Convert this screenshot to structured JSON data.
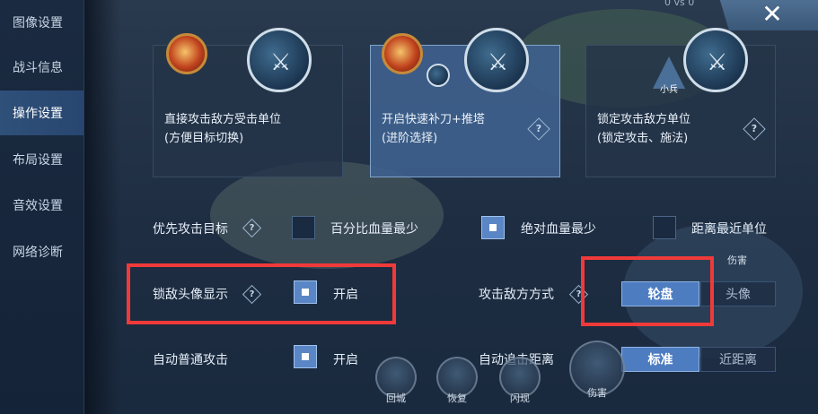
{
  "sidebar": {
    "items": [
      {
        "label": "图像设置"
      },
      {
        "label": "战斗信息"
      },
      {
        "label": "操作设置"
      },
      {
        "label": "布局设置"
      },
      {
        "label": "音效设置"
      },
      {
        "label": "网络诊断"
      }
    ],
    "active_index": 2
  },
  "header": {
    "close_glyph": "✕",
    "score_text": "0 vs 0"
  },
  "cards": [
    {
      "title": "直接攻击敌方受击单位",
      "subtitle": "(方便目标切换)",
      "selected": false
    },
    {
      "title": "开启快速补刀+推塔",
      "subtitle": "(进阶选择)",
      "selected": true
    },
    {
      "title": "锁定攻击敌方单位",
      "subtitle": "(锁定攻击、施法)",
      "selected": false,
      "tag": "小兵"
    }
  ],
  "help_glyph": "?",
  "settings": {
    "priority_target": {
      "label": "优先攻击目标",
      "options": [
        {
          "label": "百分比血量最少",
          "checked": false
        },
        {
          "label": "绝对血量最少",
          "checked": true
        },
        {
          "label": "距离最近单位",
          "checked": false
        }
      ]
    },
    "lock_avatar": {
      "label": "锁敌头像显示",
      "checked": true,
      "value_label": "开启"
    },
    "attack_mode": {
      "label": "攻击敌方方式",
      "options": [
        "轮盘",
        "头像"
      ],
      "selected": "轮盘"
    },
    "auto_attack": {
      "label": "自动普通攻击",
      "checked": true,
      "value_label": "开启"
    },
    "chase_distance": {
      "label": "自动追击距离",
      "options": [
        "标准",
        "近距离"
      ],
      "selected": "标准"
    }
  },
  "background_labels": {
    "skill_1": "回城",
    "skill_2": "恢复",
    "skill_3": "闪现",
    "skill_4": "伤害",
    "skill_5": "伤害"
  },
  "colors": {
    "highlight": "#f03a3a",
    "accent": "#4d7cc0",
    "sidebar_active": "#2e5079"
  }
}
